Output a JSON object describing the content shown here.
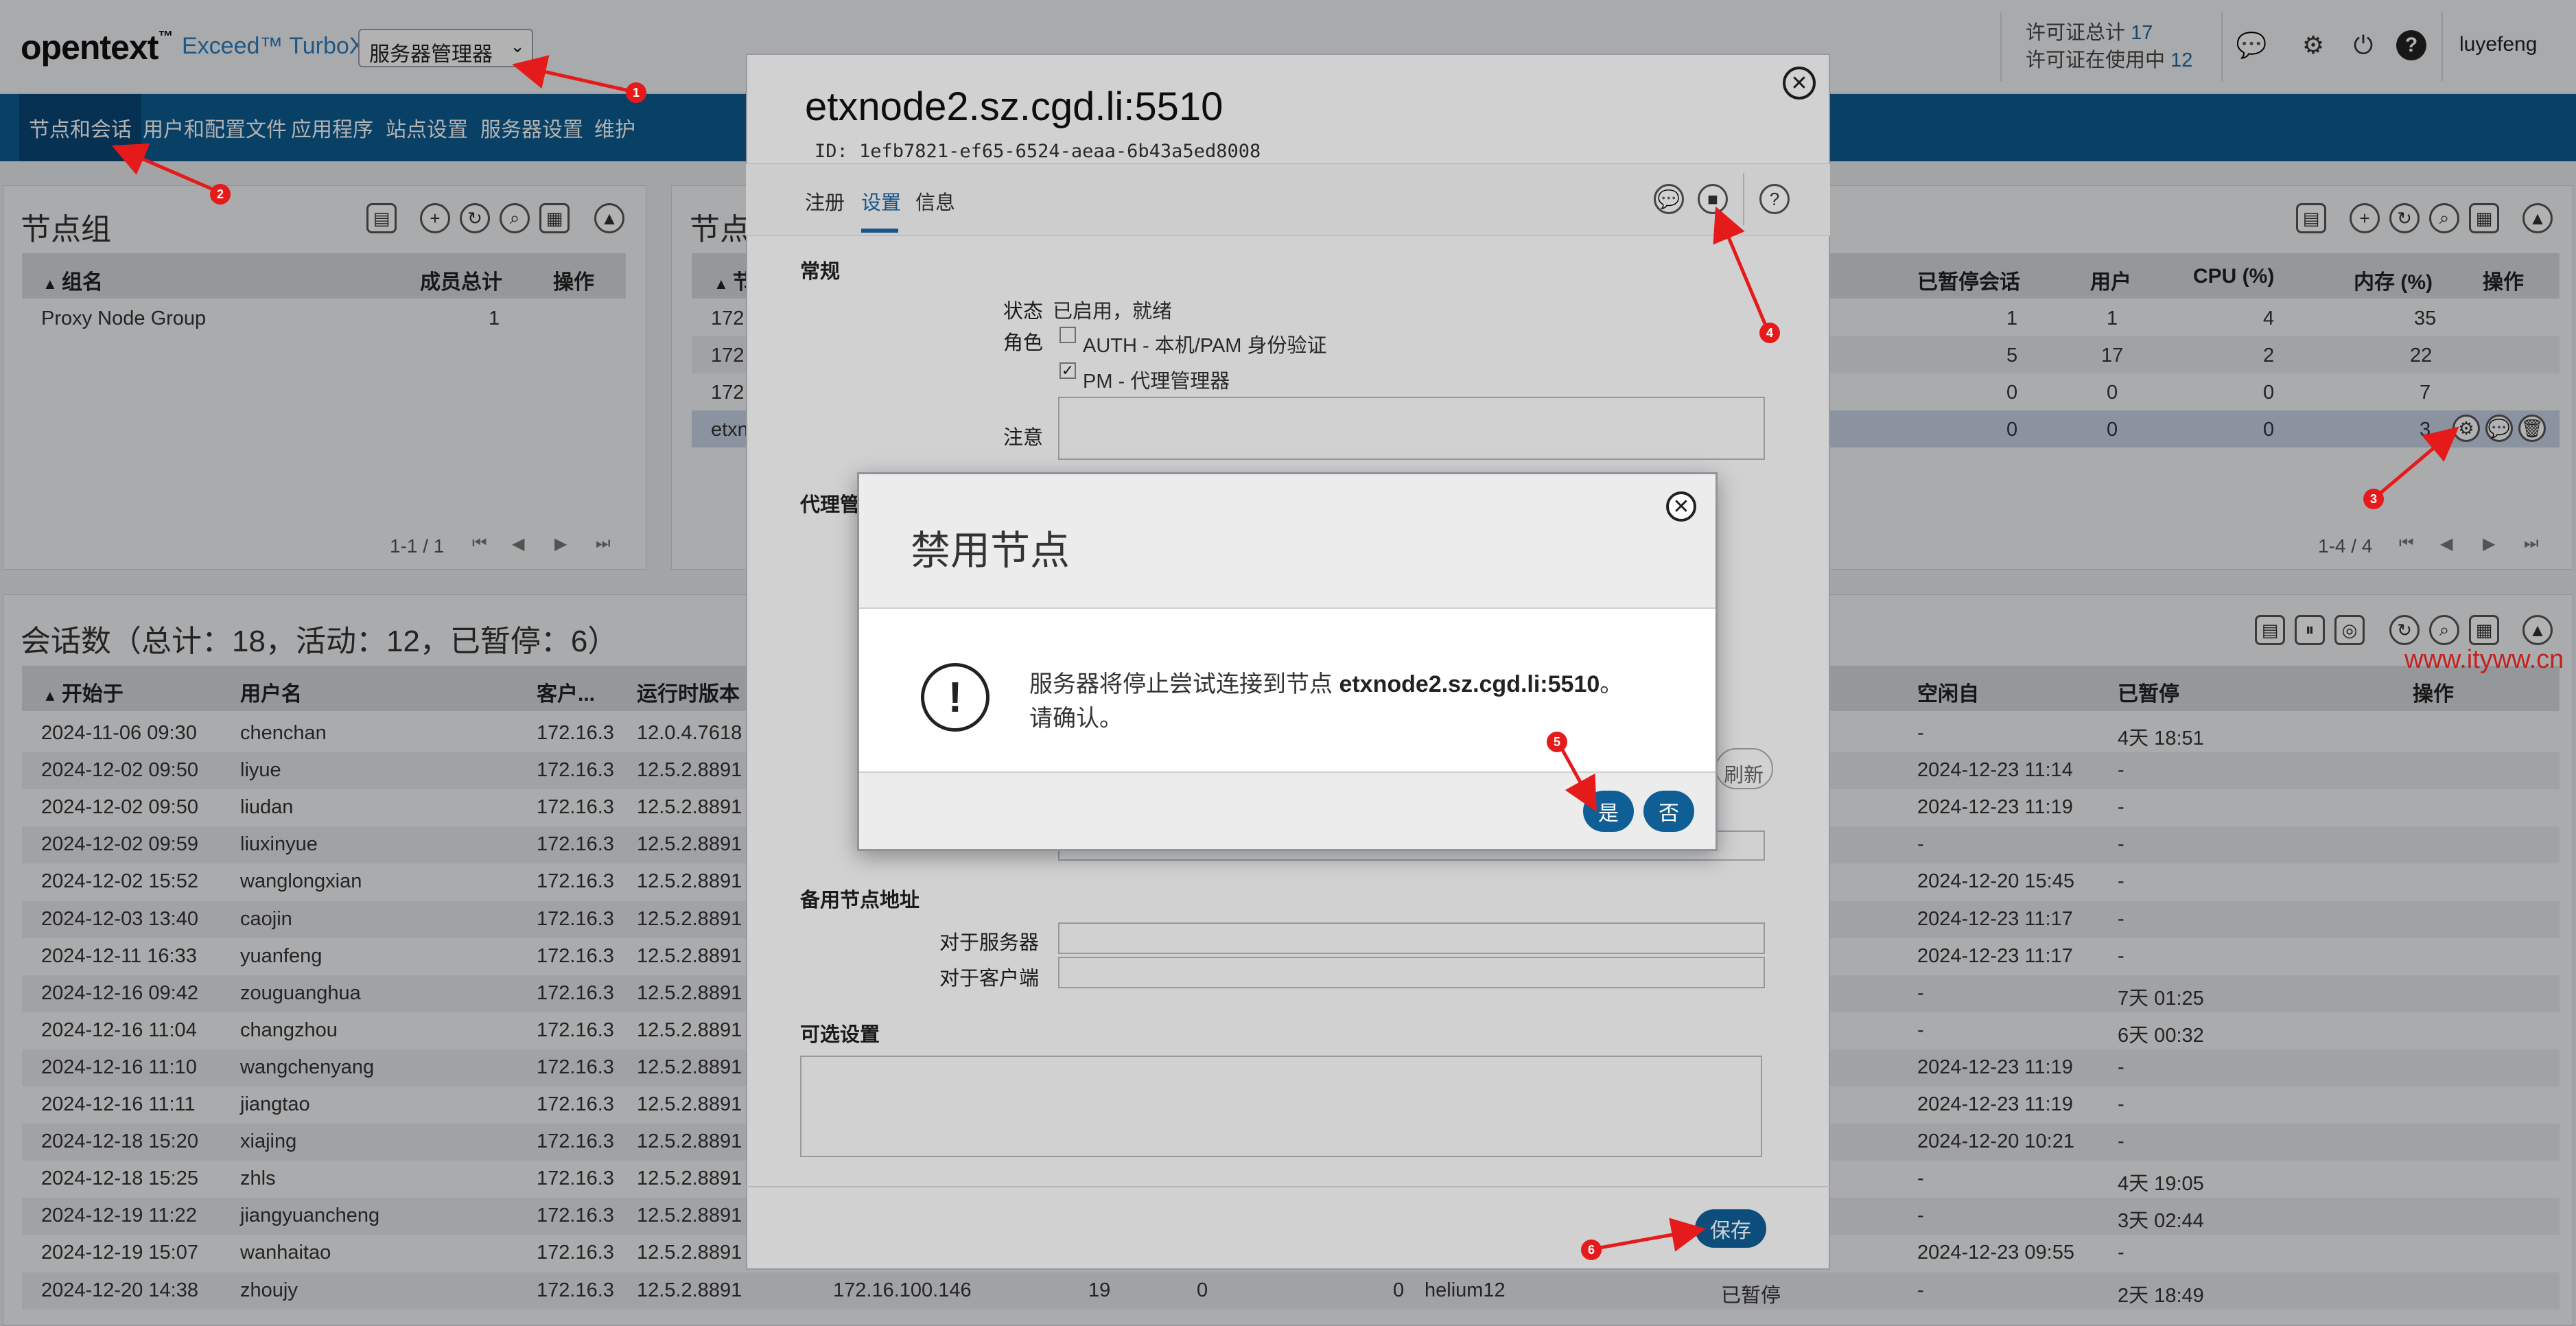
{
  "header": {
    "logo": "opentext",
    "logo_tm": "™",
    "product": "Exceed™ TurboX",
    "server_select": "服务器管理器",
    "license_total_label": "许可证总计",
    "license_total": "17",
    "license_used_label": "许可证在使用中",
    "license_used": "12",
    "user": "luyefeng"
  },
  "nav": [
    "节点和会话",
    "用户和配置文件",
    "应用程序",
    "站点设置",
    "服务器设置",
    "维护"
  ],
  "node_groups": {
    "title": "节点组",
    "columns": [
      "组名",
      "成员总计",
      "操作"
    ],
    "rows": [
      {
        "name": "Proxy Node Group",
        "count": "1"
      }
    ],
    "pager": "1-1 / 1"
  },
  "nodes": {
    "title": "节点",
    "columns": [
      "节",
      "已暂停会话",
      "用户",
      "CPU (%)",
      "内存 (%)",
      "操作"
    ],
    "rows": [
      {
        "name": "172",
        "paused": "1",
        "users": "1",
        "cpu": "4",
        "mem": "35"
      },
      {
        "name": "172",
        "paused": "5",
        "users": "17",
        "cpu": "2",
        "mem": "22"
      },
      {
        "name": "172",
        "paused": "0",
        "users": "0",
        "cpu": "0",
        "mem": "7"
      },
      {
        "name": "etxn",
        "paused": "0",
        "users": "0",
        "cpu": "0",
        "mem": "3"
      }
    ],
    "pager": "1-4 / 4"
  },
  "sessions": {
    "title": "会话数（总计：18，活动：12，已暂停：6）",
    "columns": [
      "开始于",
      "用户名",
      "客户...",
      "运行时版本",
      "空闲自",
      "已暂停",
      "操作"
    ],
    "rows": [
      {
        "start": "2024-11-06 09:30",
        "user": "chenchan",
        "client": "172.16.3",
        "ver": "12.0.4.7618",
        "idle": "-",
        "paused": "4天 18:51"
      },
      {
        "start": "2024-12-02 09:50",
        "user": "liyue",
        "client": "172.16.3",
        "ver": "12.5.2.8891",
        "idle": "2024-12-23 11:14",
        "paused": "-"
      },
      {
        "start": "2024-12-02 09:50",
        "user": "liudan",
        "client": "172.16.3",
        "ver": "12.5.2.8891",
        "idle": "2024-12-23 11:19",
        "paused": "-"
      },
      {
        "start": "2024-12-02 09:59",
        "user": "liuxinyue",
        "client": "172.16.3",
        "ver": "12.5.2.8891",
        "idle": "-",
        "paused": "-"
      },
      {
        "start": "2024-12-02 15:52",
        "user": "wanglongxian",
        "client": "172.16.3",
        "ver": "12.5.2.8891",
        "idle": "2024-12-20 15:45",
        "paused": "-"
      },
      {
        "start": "2024-12-03 13:40",
        "user": "caojin",
        "client": "172.16.3",
        "ver": "12.5.2.8891",
        "idle": "2024-12-23 11:17",
        "paused": "-"
      },
      {
        "start": "2024-12-11 16:33",
        "user": "yuanfeng",
        "client": "172.16.3",
        "ver": "12.5.2.8891",
        "idle": "2024-12-23 11:17",
        "paused": "-"
      },
      {
        "start": "2024-12-16 09:42",
        "user": "zouguanghua",
        "client": "172.16.3",
        "ver": "12.5.2.8891",
        "idle": "-",
        "paused": "7天 01:25"
      },
      {
        "start": "2024-12-16 11:04",
        "user": "changzhou",
        "client": "172.16.3",
        "ver": "12.5.2.8891",
        "idle": "-",
        "paused": "6天 00:32"
      },
      {
        "start": "2024-12-16 11:10",
        "user": "wangchenyang",
        "client": "172.16.3",
        "ver": "12.5.2.8891",
        "idle": "2024-12-23 11:19",
        "paused": "-"
      },
      {
        "start": "2024-12-16 11:11",
        "user": "jiangtao",
        "client": "172.16.3",
        "ver": "12.5.2.8891",
        "idle": "2024-12-23 11:19",
        "paused": "-"
      },
      {
        "start": "2024-12-18 15:20",
        "user": "xiajing",
        "client": "172.16.3",
        "ver": "12.5.2.8891",
        "idle": "2024-12-20 10:21",
        "paused": "-"
      },
      {
        "start": "2024-12-18 15:25",
        "user": "zhls",
        "client": "172.16.3",
        "ver": "12.5.2.8891",
        "idle": "-",
        "paused": "4天 19:05"
      },
      {
        "start": "2024-12-19 11:22",
        "user": "jiangyuancheng",
        "client": "172.16.3",
        "ver": "12.5.2.8891",
        "idle": "-",
        "paused": "3天 02:44"
      },
      {
        "start": "2024-12-19 15:07",
        "user": "wanhaitao",
        "client": "172.16.3",
        "ver": "12.5.2.8891",
        "idle": "2024-12-23 09:55",
        "paused": "-"
      },
      {
        "start": "2024-12-20 14:38",
        "user": "zhoujy",
        "client": "172.16.3",
        "ver": "12.5.2.8891",
        "idle": "-",
        "paused": "2天 18:49",
        "ip": "172.16.100.146",
        "c1": "19",
        "c2": "0",
        "c3": "0",
        "node": "helium12",
        "status": "已暂停"
      }
    ]
  },
  "node_dialog": {
    "title": "etxnode2.sz.cgd.li:5510",
    "id": "ID:  1efb7821-ef65-6524-aeaa-6b43a5ed8008",
    "tabs": [
      "注册",
      "设置",
      "信息"
    ],
    "general_section": "常规",
    "status_label": "状态",
    "status_value": "已启用，就绪",
    "role_label": "角色",
    "role_auth": "AUTH - 本机/PAM 身份验证",
    "role_pm": "PM - 代理管理器",
    "note_label": "注意",
    "proxy_section": "代理管",
    "refresh_partial": "刷新",
    "backup_section": "备用节点地址",
    "for_server": "对于服务器",
    "for_client": "对于客户端",
    "optional_section": "可选设置",
    "save": "保存"
  },
  "confirm": {
    "title": "禁用节点",
    "message_prefix": "服务器将停止尝试连接到节点 ",
    "message_node": "etxnode2.sz.cgd.li:5510",
    "message_suffix": "。",
    "message_line2": "请确认。",
    "yes": "是",
    "no": "否"
  },
  "annotations": [
    "1",
    "2",
    "3",
    "4",
    "5",
    "6"
  ],
  "watermark": "www.ityww.cn",
  "colors": {
    "nav": "#0d5c93",
    "accent": "#1f6aa8",
    "annotation": "#e51a1a"
  }
}
